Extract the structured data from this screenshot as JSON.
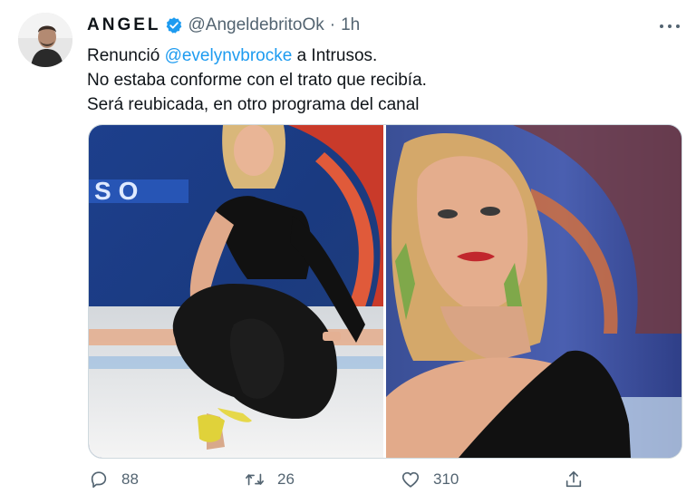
{
  "tweet": {
    "display_name": "ANGEL",
    "handle": "@AngeldebritoOk",
    "separator": "·",
    "time": "1h",
    "text_line1_prefix": "Renunció ",
    "mention": "@evelynvbrocke",
    "text_line1_suffix": " a Intrusos.",
    "text_line2": "No estaba conforme con el trato que recibía.",
    "text_line3": "Será reubicada, en otro programa del canal"
  },
  "actions": {
    "replies": "88",
    "retweets": "26",
    "likes": "310"
  },
  "icons": {
    "verified": "verified-badge-icon",
    "more": "more-options-icon",
    "reply": "reply-icon",
    "retweet": "retweet-icon",
    "like": "heart-icon",
    "share": "share-icon"
  },
  "colors": {
    "accent": "#1d9bf0",
    "secondary_text": "#536471",
    "primary_text": "#0f1419"
  }
}
